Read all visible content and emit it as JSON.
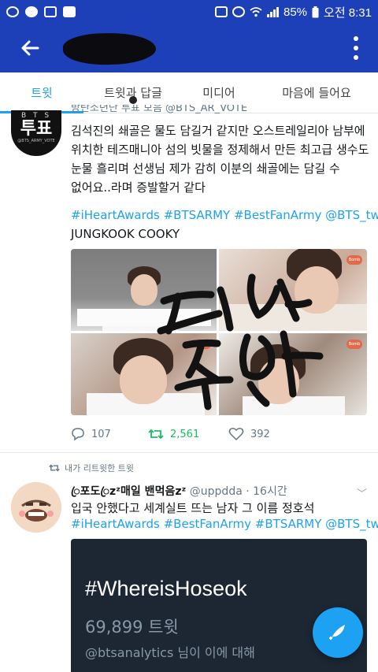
{
  "statusbar": {
    "battery": "85%",
    "time": "오전 8:31"
  },
  "tabs": [
    {
      "label": "트윗"
    },
    {
      "label": "트윗과 답글"
    },
    {
      "label": "미디어"
    },
    {
      "label": "마음에 들어요"
    }
  ],
  "tweet1": {
    "avatar": {
      "top": "B T S",
      "main": "투표",
      "sub": "@BTS_ARMY_VOTE"
    },
    "header_cut": "방탄소년단 투표 모음 @BTS_AR_VOTE",
    "body_lines": [
      "김석진의 쇄골은 물도 담길거 같지만 오스트레일리아 남부에",
      "위치한 테즈매니아 섬의 빗물을 정제해서 만든 최고급 생수도",
      "눈물 흘리며 선생님 제가 감히 이분의 쇄골에는 담길 수",
      "없어요..라며 증발할거 같다"
    ],
    "hashtags": "#iHeartAwards #BTSARMY #BestFanArmy @BTS_twt",
    "extra_line": "JUNGKOOK COOKY",
    "image_badge": "Bomb",
    "replies": "107",
    "retweets": "2,561",
    "likes": "392"
  },
  "tweet2": {
    "retweet_label": "내가 리트윗한 트윗",
    "name": "ꦿ포도ꦿzᶻ매일 밴먹음zᶻ",
    "handle": "@uppdda",
    "time": "· 16시간",
    "text": "입국 안했다고 세계실트 뜨는 남자 그 이름 정호석",
    "hashtags": "#iHeartAwards #BestFanArmy #BTSARMY @BTS_twt",
    "card": {
      "title": "#WhereisHoseok",
      "count": "69,899 트윗",
      "note": "@btsanalytics 님이 이에 대해"
    }
  },
  "colors": {
    "bar": "#1d3fb8",
    "accent": "#1da1f2",
    "retweet": "#17bf63"
  }
}
